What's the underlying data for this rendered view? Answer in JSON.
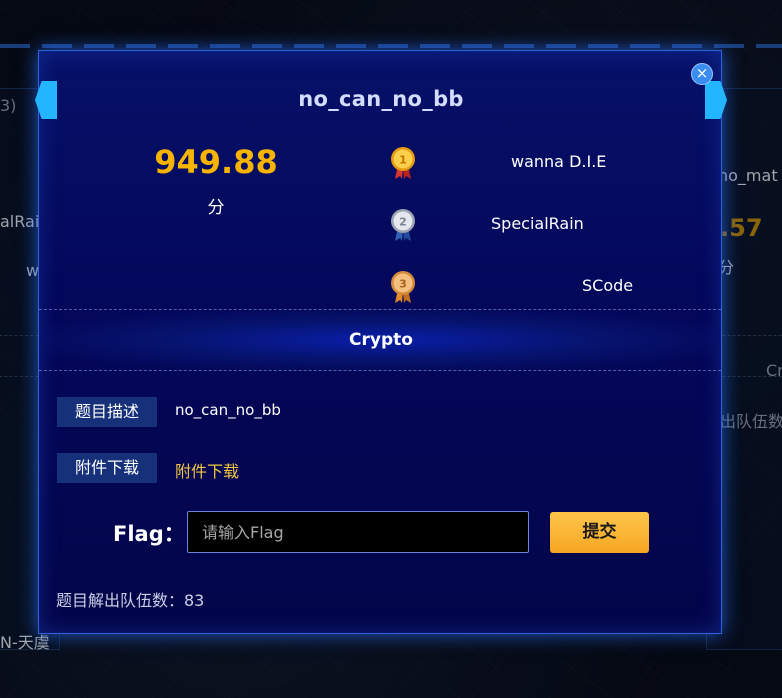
{
  "background": {
    "left_texts": [
      "3)",
      "alRain",
      "w",
      "N-天虞"
    ],
    "right_texts": [
      "no_mat",
      ".57",
      "分",
      "Cr",
      "出队伍数"
    ]
  },
  "modal": {
    "title": "no_can_no_bb",
    "close_icon": "×",
    "score": "949.88",
    "score_unit": "分",
    "ranking": [
      {
        "rank": "1",
        "team": "wanna D.I.E",
        "medal": "gold-medal-icon",
        "color": "#f4b422"
      },
      {
        "rank": "2",
        "team": "SpecialRain",
        "medal": "silver-medal-icon",
        "color": "#c9ced6"
      },
      {
        "rank": "3",
        "team": "SCode",
        "medal": "bronze-medal-icon",
        "color": "#e9a55a"
      }
    ],
    "category": "Crypto",
    "description_label": "题目描述",
    "description_value": "no_can_no_bb",
    "attachment_label": "附件下载",
    "attachment_link": "附件下载",
    "flag_label": "Flag：",
    "flag_placeholder": "请输入Flag",
    "flag_value": "",
    "submit_label": "提交",
    "solve_count_text": "题目解出队伍数：83"
  },
  "colors": {
    "accent": "#2c63d8",
    "score": "#f6b400",
    "link": "#f2c542",
    "submit": "#f5a623"
  }
}
